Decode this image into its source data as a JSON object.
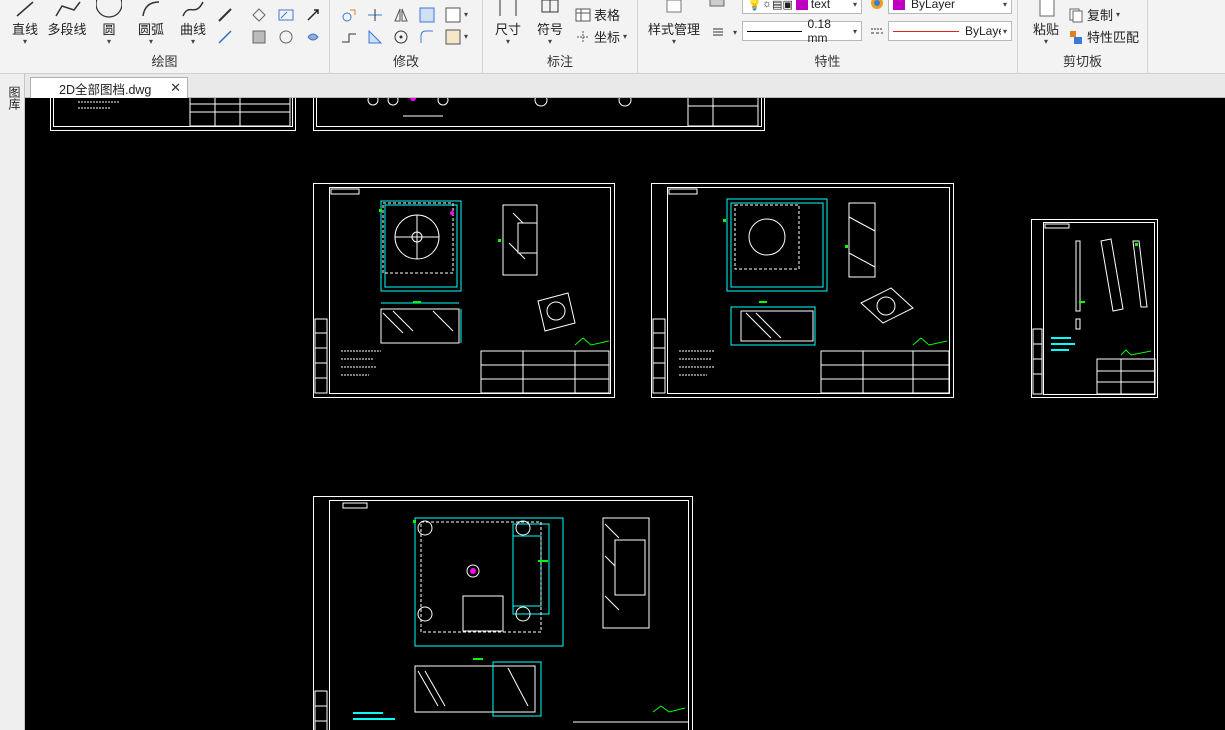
{
  "ribbon": {
    "draw_panel": {
      "title": "绘图",
      "tools": [
        {
          "label": "直线",
          "icon": "line-icon"
        },
        {
          "label": "多段线",
          "icon": "polyline-icon"
        },
        {
          "label": "圆",
          "icon": "circle-icon"
        },
        {
          "label": "圆弧",
          "icon": "arc-icon"
        },
        {
          "label": "曲线",
          "icon": "spline-icon"
        }
      ]
    },
    "modify_panel": {
      "title": "修改"
    },
    "annotate_panel": {
      "title": "标注",
      "dimension_label": "尺寸",
      "symbol_label": "符号",
      "table_label": "表格",
      "coordinate_label": "坐标"
    },
    "properties_panel": {
      "title": "特性",
      "style_manager_label": "样式管理",
      "layer_value": "text",
      "color_value": "ByLayer",
      "lineweight_value": "0.18 mm",
      "linetype_value": "ByLayer"
    },
    "clipboard_panel": {
      "title": "剪切板",
      "paste_label": "粘贴",
      "copy_label": "复制",
      "match_label": "特性匹配"
    }
  },
  "tabs": {
    "active": "2D全部图档.dwg"
  },
  "left_strip": {
    "label": "图库"
  },
  "colors": {
    "canvas": "#000000",
    "frame": "#ffffff",
    "dimension": "#00ffff",
    "hatch": "#ffffff",
    "marker": "#00ff00",
    "layer_swatch": "#c000c0",
    "linetype_red": "#e02020"
  }
}
